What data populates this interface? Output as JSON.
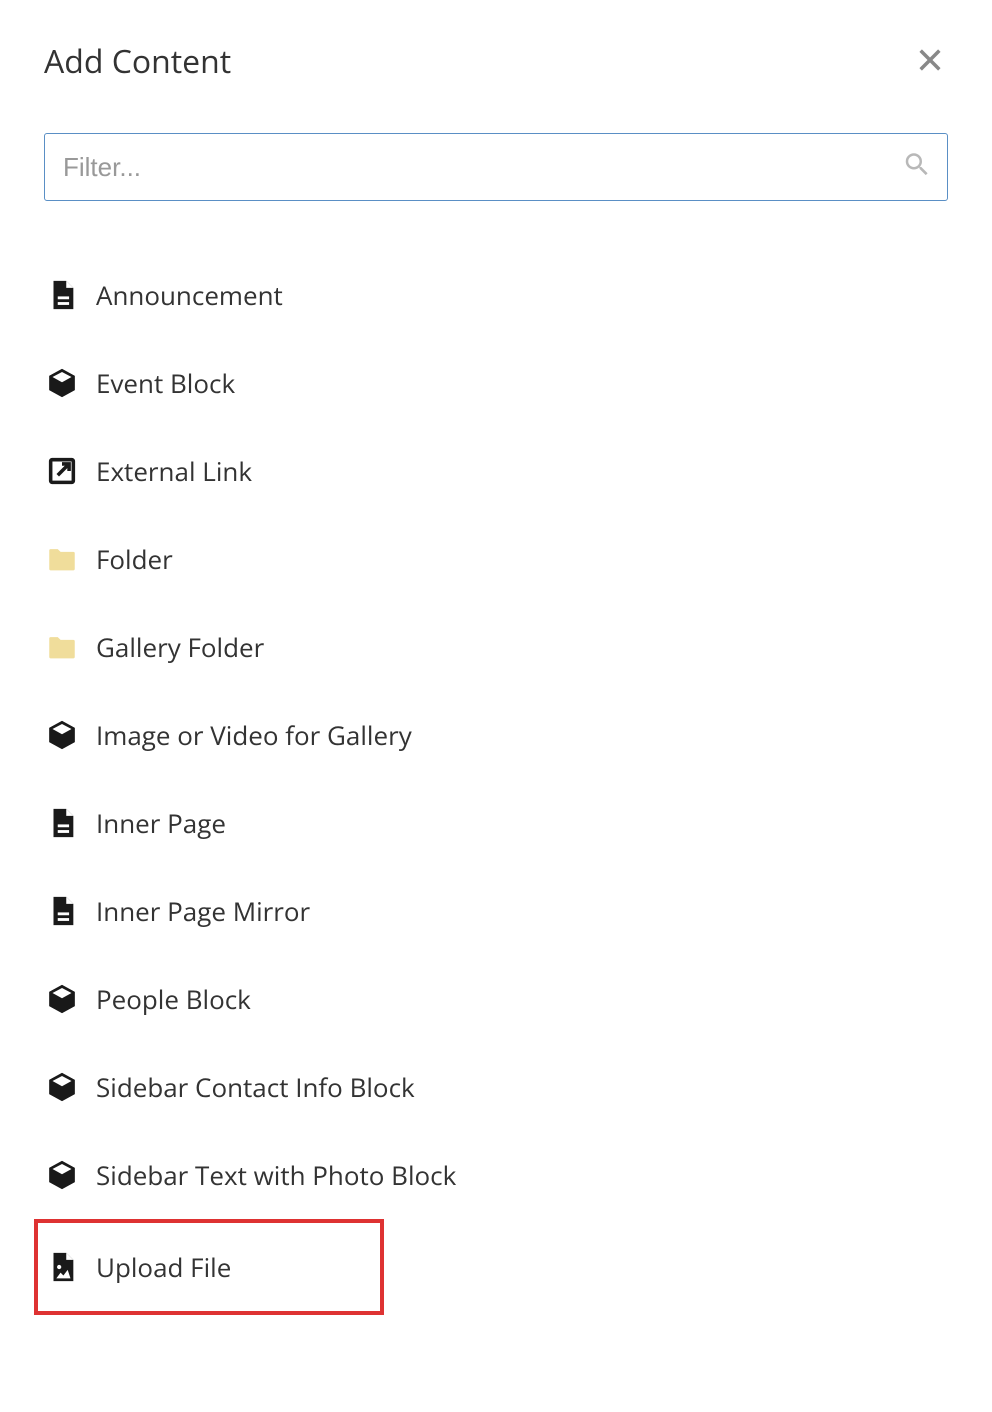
{
  "dialog": {
    "title": "Add Content",
    "filter_placeholder": "Filter..."
  },
  "items": [
    {
      "label": "Announcement",
      "icon": "page"
    },
    {
      "label": "Event Block",
      "icon": "cube"
    },
    {
      "label": "External Link",
      "icon": "external-link"
    },
    {
      "label": "Folder",
      "icon": "folder"
    },
    {
      "label": "Gallery Folder",
      "icon": "folder"
    },
    {
      "label": "Image or Video for Gallery",
      "icon": "cube"
    },
    {
      "label": "Inner Page",
      "icon": "page"
    },
    {
      "label": "Inner Page Mirror",
      "icon": "page"
    },
    {
      "label": "People Block",
      "icon": "cube"
    },
    {
      "label": "Sidebar Contact Info Block",
      "icon": "cube"
    },
    {
      "label": "Sidebar Text with Photo Block",
      "icon": "cube"
    },
    {
      "label": "Upload File",
      "icon": "upload-image",
      "highlighted": true
    }
  ]
}
